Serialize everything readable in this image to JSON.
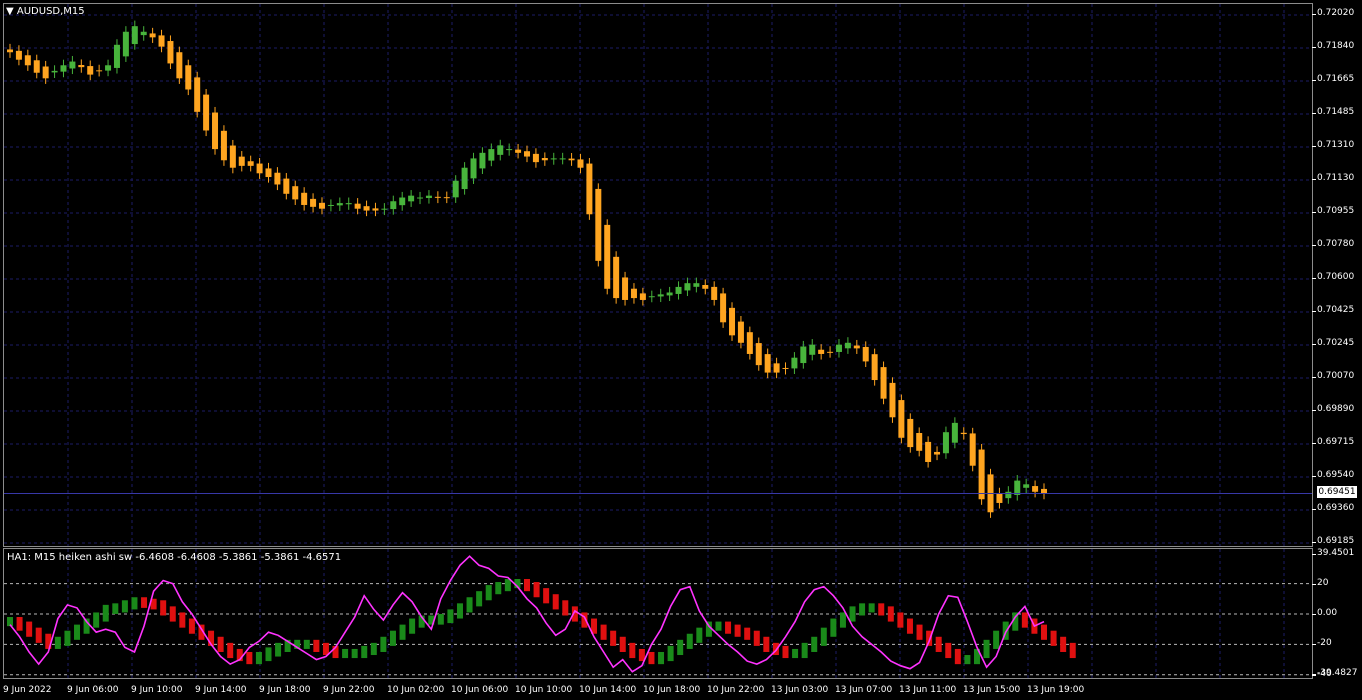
{
  "window": {
    "symbol_title": "AUDUSD,M15",
    "indicator_title": "HA1: M15 heiken ashi sw -6.4608 -6.4608 -5.3861 -5.3861 -4.6571"
  },
  "colors": {
    "background": "#000000",
    "grid": "#1c1c66",
    "bull_candle": "#48b43c",
    "bear_candle": "#ffa520",
    "indicator_line": "#ff33ff",
    "indicator_bull": "#1a8a1a",
    "indicator_bear": "#e01010",
    "level_line": "#b8b8b8"
  },
  "price_axis": {
    "ticks": [
      "0.72020",
      "0.71840",
      "0.71665",
      "0.71485",
      "0.71310",
      "0.71130",
      "0.70955",
      "0.70780",
      "0.70600",
      "0.70425",
      "0.70245",
      "0.70070",
      "0.69890",
      "0.69715",
      "0.69540",
      "0.69360",
      "0.69185"
    ],
    "current_price": "0.69451"
  },
  "indicator_axis": {
    "ticks": [
      "39.4501",
      "20",
      "0.00",
      "-20",
      "-39.4827",
      "-40"
    ],
    "levels": [
      20,
      0,
      -20,
      -40
    ]
  },
  "time_axis": {
    "labels": [
      "9 Jun 2022",
      "9 Jun 06:00",
      "9 Jun 10:00",
      "9 Jun 14:00",
      "9 Jun 18:00",
      "9 Jun 22:00",
      "10 Jun 02:00",
      "10 Jun 06:00",
      "10 Jun 10:00",
      "10 Jun 14:00",
      "10 Jun 18:00",
      "10 Jun 22:00",
      "13 Jun 03:00",
      "13 Jun 07:00",
      "13 Jun 11:00",
      "13 Jun 15:00",
      "13 Jun 19:00"
    ]
  },
  "chart_data": [
    {
      "type": "candlestick",
      "title": "AUDUSD,M15",
      "ylim": [
        0.69185,
        0.7202
      ],
      "close_series": [
        0.7182,
        0.7178,
        0.7175,
        0.7171,
        0.7168,
        0.7172,
        0.7175,
        0.7177,
        0.7174,
        0.717,
        0.7172,
        0.7175,
        0.7186,
        0.7193,
        0.7196,
        0.7193,
        0.719,
        0.7185,
        0.7176,
        0.7168,
        0.7162,
        0.715,
        0.714,
        0.713,
        0.7124,
        0.712,
        0.7121,
        0.7121,
        0.7117,
        0.7115,
        0.7111,
        0.7106,
        0.7103,
        0.71,
        0.7099,
        0.7098,
        0.71,
        0.7101,
        0.7101,
        0.7098,
        0.7097,
        0.7097,
        0.7098,
        0.7102,
        0.7104,
        0.7105,
        0.7104,
        0.7105,
        0.7104,
        0.7104,
        0.7113,
        0.712,
        0.7125,
        0.7128,
        0.713,
        0.7132,
        0.713,
        0.7128,
        0.7126,
        0.7123,
        0.7124,
        0.7125,
        0.7125,
        0.7124,
        0.712,
        0.7095,
        0.707,
        0.7055,
        0.705,
        0.7049,
        0.705,
        0.7049,
        0.7051,
        0.7052,
        0.7053,
        0.7056,
        0.7058,
        0.7058,
        0.7055,
        0.7049,
        0.7037,
        0.703,
        0.7026,
        0.702,
        0.7014,
        0.701,
        0.701,
        0.7012,
        0.7018,
        0.7024,
        0.7025,
        0.702,
        0.7021,
        0.7025,
        0.7026,
        0.7023,
        0.7016,
        0.7006,
        0.6996,
        0.6986,
        0.6975,
        0.697,
        0.6968,
        0.6962,
        0.6966,
        0.6978,
        0.6983,
        0.6977,
        0.696,
        0.6942,
        0.6935,
        0.694,
        0.6946,
        0.6952,
        0.695,
        0.6946,
        0.6945
      ]
    },
    {
      "type": "line",
      "title": "HA1: M15 heiken ashi sw",
      "ylim": [
        -39.4827,
        39.4501
      ],
      "series": [
        {
          "values": [
            -7,
            -15,
            -25,
            -33,
            -25,
            -3,
            6,
            4,
            -5,
            -12,
            -10,
            -12,
            -22,
            -25,
            -8,
            15,
            22,
            20,
            8,
            0,
            -10,
            -20,
            -28,
            -33,
            -30,
            -22,
            -18,
            -12,
            -14,
            -18,
            -22,
            -26,
            -30,
            -28,
            -22,
            -12,
            -2,
            12,
            3,
            -4,
            6,
            14,
            8,
            -2,
            -10,
            10,
            22,
            32,
            38,
            32,
            30,
            25,
            24,
            18,
            10,
            4,
            -6,
            -14,
            -10,
            2,
            -2,
            -15,
            -25,
            -35,
            -30,
            -38,
            -34,
            -20,
            -10,
            5,
            16,
            18,
            2,
            -8,
            -14,
            -20,
            -25,
            -31,
            -33,
            -30,
            -24,
            -15,
            -5,
            8,
            16,
            18,
            12,
            4,
            -8,
            -15,
            -20,
            -25,
            -31,
            -34,
            -36,
            -32,
            -18,
            0,
            12,
            11,
            -5,
            -22,
            -35,
            -28,
            -12,
            -2,
            5,
            -8,
            -5
          ]
        },
        {
          "values": [
            -5,
            -8,
            -12,
            -16,
            -20,
            -18,
            -14,
            -10,
            -6,
            -2,
            3,
            4,
            6,
            8,
            7,
            6,
            2,
            -2,
            -6,
            -10,
            -14,
            -18,
            -22,
            -26,
            -28,
            -30,
            -28,
            -25,
            -22,
            -20,
            -20,
            -20,
            -22,
            -24,
            -26,
            -26,
            -26,
            -24,
            -22,
            -18,
            -14,
            -10,
            -6,
            -4,
            -4,
            -3,
            0,
            4,
            8,
            12,
            16,
            18,
            20,
            20,
            18,
            14,
            10,
            6,
            2,
            -2,
            -6,
            -10,
            -14,
            -18,
            -22,
            -26,
            -28,
            -30,
            -28,
            -24,
            -20,
            -16,
            -12,
            -8,
            -8,
            -10,
            -12,
            -14,
            -18,
            -22,
            -24,
            -26,
            -26,
            -22,
            -18,
            -12,
            -6,
            -2,
            2,
            4,
            4,
            2,
            -2,
            -6,
            -10,
            -14,
            -18,
            -22,
            -26,
            -30,
            -30,
            -26,
            -20,
            -14,
            -8,
            -2,
            -6,
            -10,
            -14,
            -18,
            -22,
            -26
          ]
        }
      ]
    }
  ]
}
